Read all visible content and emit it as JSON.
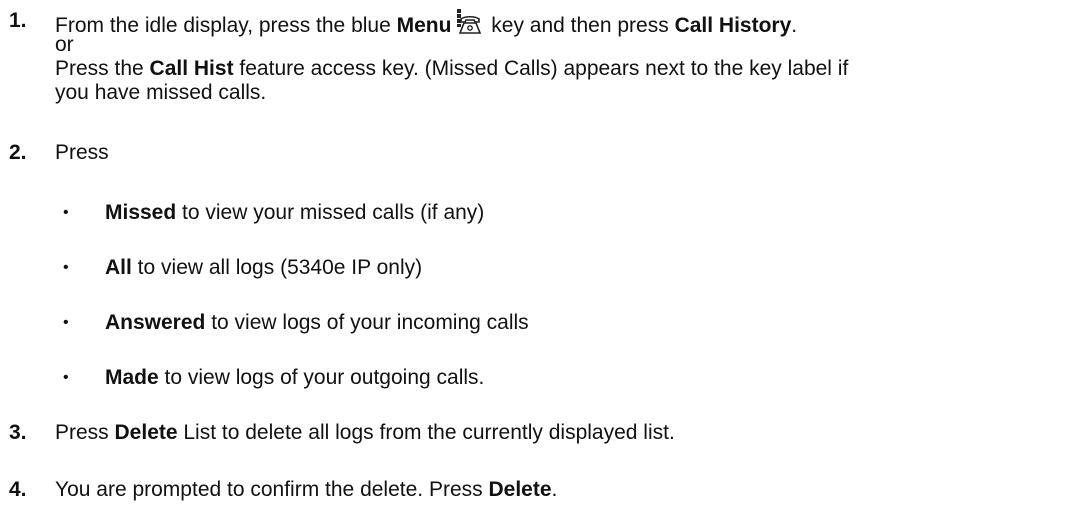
{
  "steps": [
    {
      "number": "1.",
      "parts": {
        "t1": "From the idle display, press the blue ",
        "b1": "Menu",
        "t2": " key and then press ",
        "b2": "Call History",
        "t3": ".",
        "or": "or",
        "t4": "Press the ",
        "b3": "Call Hist",
        "t5": " feature access key. (Missed Calls) appears next to the key label if",
        "t6": "you have missed calls."
      }
    },
    {
      "number": "2.",
      "text": "Press",
      "bullets": [
        {
          "bold": "Missed",
          "text": " to view your missed calls (if any)"
        },
        {
          "bold": "All",
          "text": " to view all logs (5340e IP only)"
        },
        {
          "bold": "Answered",
          "text": " to view logs of your incoming calls"
        },
        {
          "bold": "Made",
          "text": " to view logs of your outgoing calls."
        }
      ]
    },
    {
      "number": "3.",
      "parts": {
        "t1": "Press ",
        "b1": "Delete",
        "t2": " List to delete all logs from the currently displayed list."
      }
    },
    {
      "number": "4.",
      "parts": {
        "t1": "You are prompted to confirm the delete. Press ",
        "b1": "Delete",
        "t2": "."
      }
    }
  ],
  "icons": {
    "menu_key": "menu-phone-icon"
  },
  "bullet_symbol": "•"
}
